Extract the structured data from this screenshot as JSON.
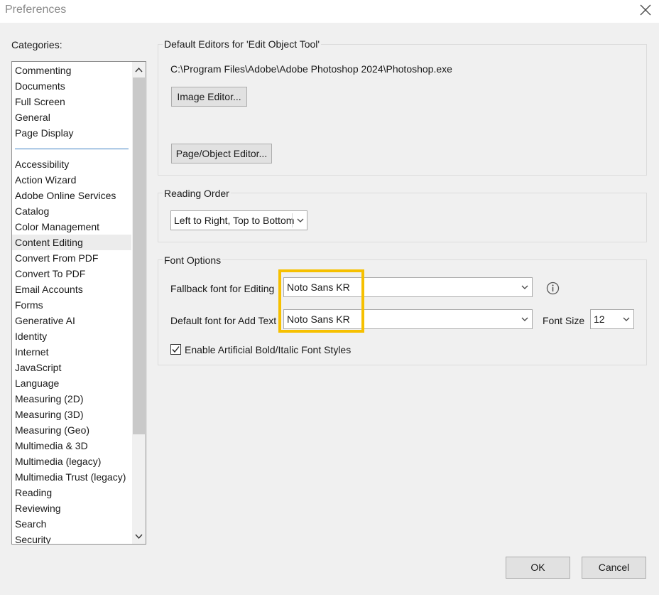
{
  "window": {
    "title": "Preferences"
  },
  "categories": {
    "label": "Categories:",
    "top_items": [
      "Commenting",
      "Documents",
      "Full Screen",
      "General",
      "Page Display"
    ],
    "items": [
      "Accessibility",
      "Action Wizard",
      "Adobe Online Services",
      "Catalog",
      "Color Management",
      "Content Editing",
      "Convert From PDF",
      "Convert To PDF",
      "Email Accounts",
      "Forms",
      "Generative AI",
      "Identity",
      "Internet",
      "JavaScript",
      "Language",
      "Measuring (2D)",
      "Measuring (3D)",
      "Measuring (Geo)",
      "Multimedia & 3D",
      "Multimedia (legacy)",
      "Multimedia Trust (legacy)",
      "Reading",
      "Reviewing",
      "Search",
      "Security"
    ],
    "selected": "Content Editing"
  },
  "default_editors": {
    "title": "Default Editors for 'Edit Object Tool'",
    "image_editor_path": "C:\\Program Files\\Adobe\\Adobe Photoshop 2024\\Photoshop.exe",
    "image_editor_button": "Image Editor...",
    "page_object_editor_button": "Page/Object Editor..."
  },
  "reading_order": {
    "title": "Reading Order",
    "value": "Left to Right, Top to Bottom"
  },
  "font_options": {
    "title": "Font Options",
    "fallback_label": "Fallback font for Editing",
    "fallback_value": "Noto Sans KR",
    "default_label": "Default font for Add Text",
    "default_value": "Noto Sans KR",
    "font_size_label": "Font Size",
    "font_size_value": "12",
    "bold_italic_label": "Enable Artificial Bold/Italic Font Styles",
    "bold_italic_checked": true
  },
  "buttons": {
    "ok": "OK",
    "cancel": "Cancel"
  },
  "colors": {
    "highlight": "#f6c000",
    "separator": "#3b7fc4"
  }
}
